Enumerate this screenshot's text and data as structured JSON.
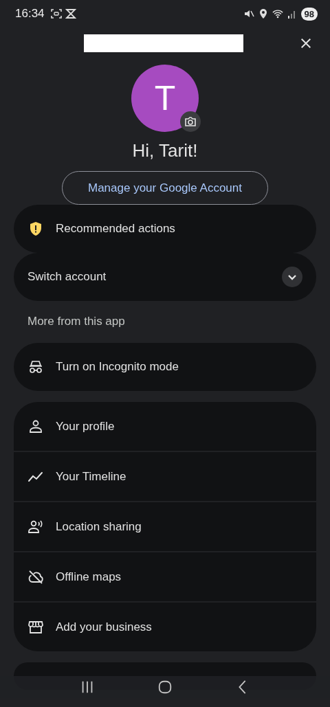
{
  "status_bar": {
    "time": "16:34",
    "battery": "98"
  },
  "profile": {
    "initial": "T",
    "greeting": "Hi, Tarit!",
    "manage_button": "Manage your Google Account"
  },
  "recommended": {
    "label": "Recommended actions"
  },
  "switch_account": {
    "label": "Switch account",
    "expanded": false
  },
  "section_title": "More from this app",
  "incognito": {
    "label": "Turn on Incognito mode"
  },
  "menu_items": [
    {
      "label": "Your profile",
      "kind": "profile"
    },
    {
      "label": "Your Timeline",
      "kind": "timeline"
    },
    {
      "label": "Location sharing",
      "kind": "sharing"
    },
    {
      "label": "Offline maps",
      "kind": "offline"
    },
    {
      "label": "Add your business",
      "kind": "business"
    }
  ]
}
